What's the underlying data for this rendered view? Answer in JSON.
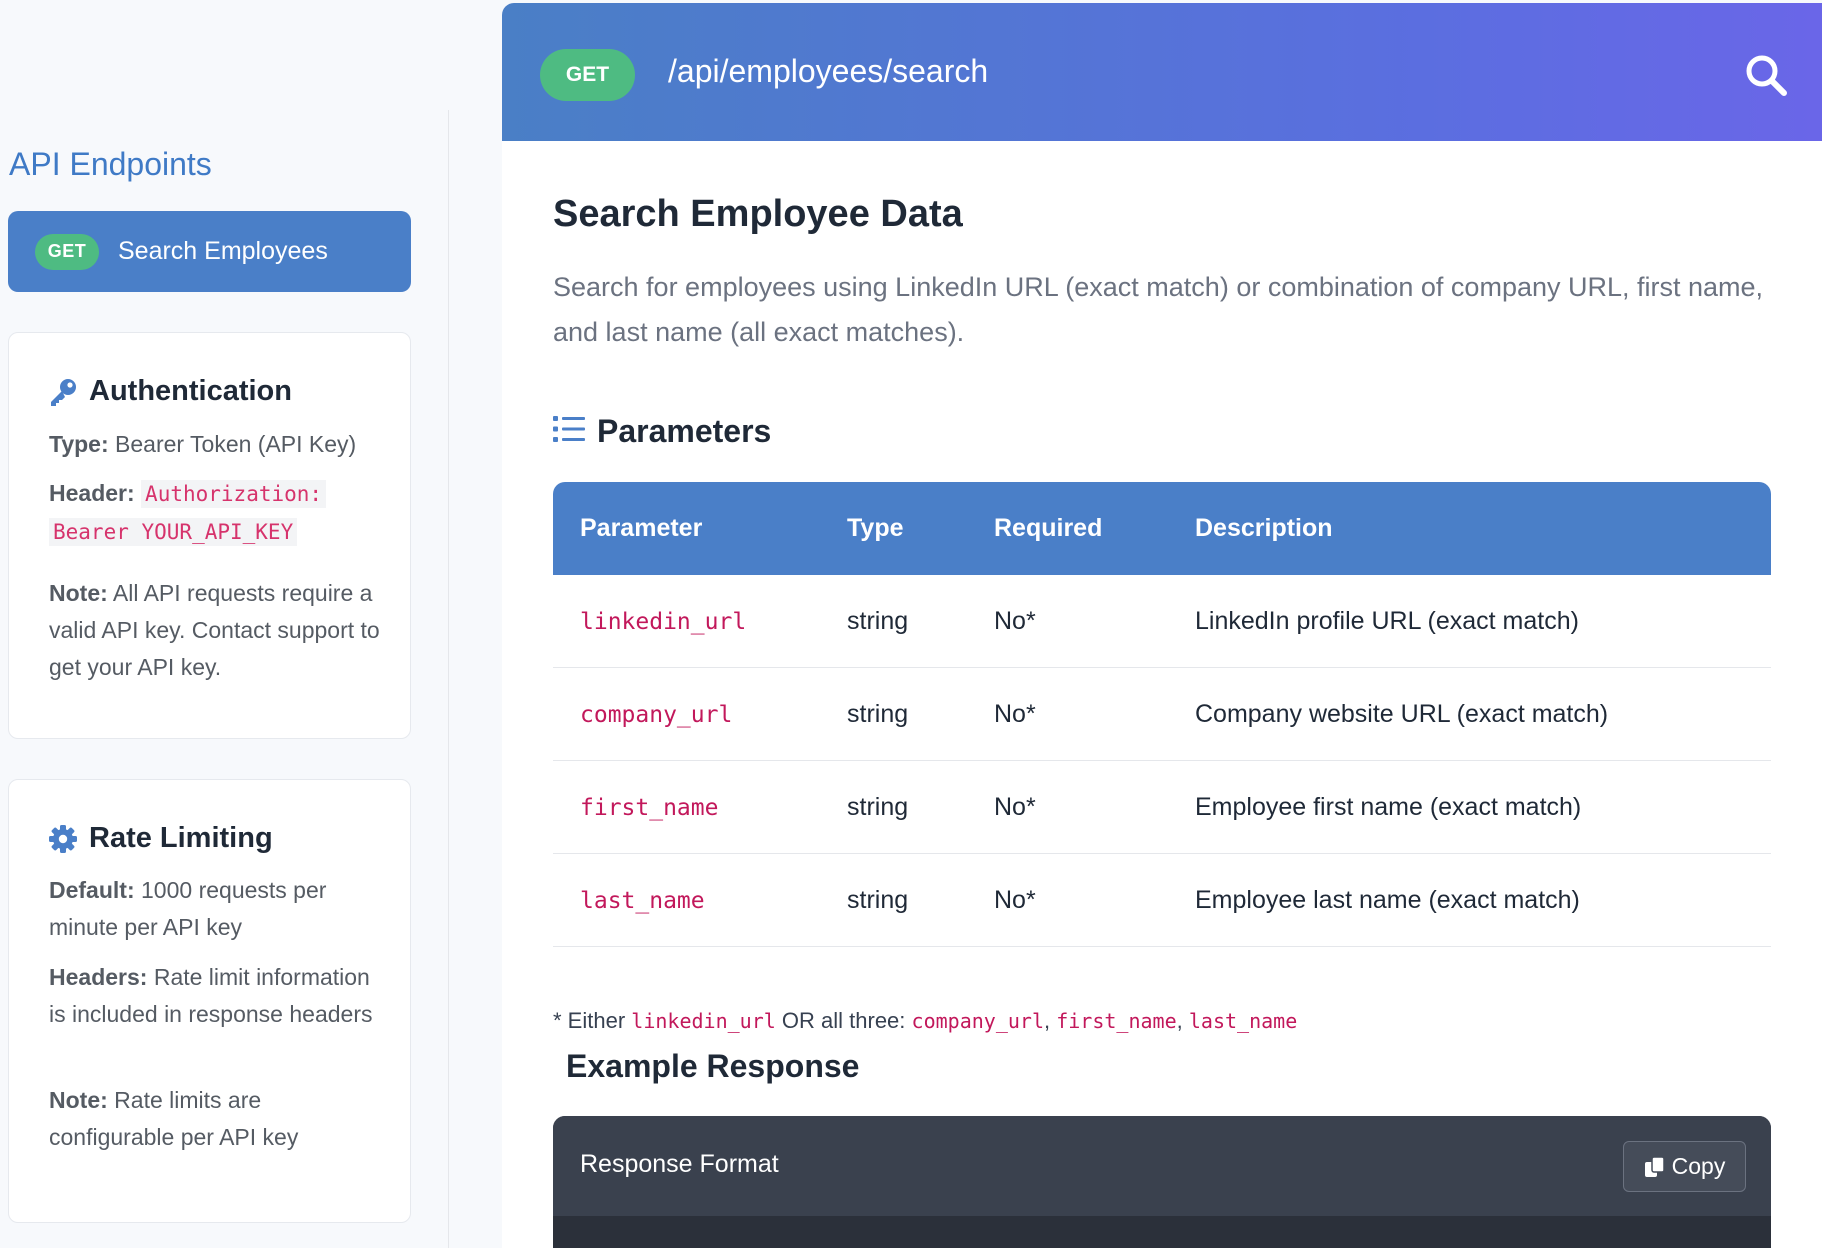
{
  "sidebar": {
    "title": "API Endpoints",
    "nav_items": [
      {
        "method": "GET",
        "label": "Search Employees",
        "active": true
      }
    ],
    "auth_card": {
      "title": "Authentication",
      "icon": "key-icon",
      "type_label": "Type:",
      "type_value": "Bearer Token (API Key)",
      "header_label": "Header:",
      "header_value_line1": "Authorization:",
      "header_value_line2": "Bearer YOUR_API_KEY",
      "note_label": "Note:",
      "note_value": "All API requests require a valid API key. Contact support to get your API key."
    },
    "rate_card": {
      "title": "Rate Limiting",
      "icon": "gear-icon",
      "default_label": "Default:",
      "default_value": "1000 requests per minute per API key",
      "headers_label": "Headers:",
      "headers_value": "Rate limit information is included in response headers",
      "note_label": "Note:",
      "note_value": "Rate limits are configurable per API key"
    }
  },
  "header": {
    "method": "GET",
    "path": "/api/employees/search",
    "search_icon": "search-icon"
  },
  "main": {
    "title": "Search Employee Data",
    "description": "Search for employees using LinkedIn URL (exact match) or combination of company URL, first name, and last name (all exact matches).",
    "params_title": "Parameters",
    "params_icon": "list-icon",
    "table": {
      "columns": [
        "Parameter",
        "Type",
        "Required",
        "Description"
      ],
      "rows": [
        {
          "parameter": "linkedin_url",
          "type": "string",
          "required": "No*",
          "description": "LinkedIn profile URL (exact match)"
        },
        {
          "parameter": "company_url",
          "type": "string",
          "required": "No*",
          "description": "Company website URL (exact match)"
        },
        {
          "parameter": "first_name",
          "type": "string",
          "required": "No*",
          "description": "Employee first name (exact match)"
        },
        {
          "parameter": "last_name",
          "type": "string",
          "required": "No*",
          "description": "Employee last name (exact match)"
        }
      ]
    },
    "footnote": {
      "prefix": "* Either",
      "code1": "linkedin_url",
      "middle": "OR all three:",
      "code2": "company_url",
      "code3": "first_name",
      "code4": "last_name"
    },
    "example_title": "Example Response",
    "response": {
      "label": "Response Format",
      "copy_label": "Copy",
      "copy_icon": "copy-icon"
    }
  },
  "colors": {
    "accent": "#4a7fc8",
    "badge_green": "#4ebb82",
    "header_gradient_start": "#4a7fc6",
    "header_gradient_end": "#6a66e8",
    "code_pink": "#c2185b"
  }
}
